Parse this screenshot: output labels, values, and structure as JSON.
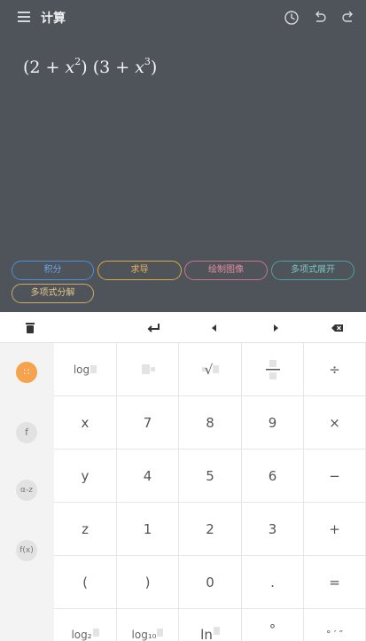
{
  "app": {
    "title": "计算"
  },
  "expression": {
    "part1_open": "(2 + ",
    "var1": "x",
    "exp1": "2",
    "part1_close": ")",
    "part2_open": "(3 + ",
    "var2": "x",
    "exp2": "3",
    "part2_close": ")"
  },
  "actions": [
    "积分",
    "求导",
    "绘制图像",
    "多项式展开",
    "多项式分解"
  ],
  "side_panel": [
    "∷",
    "f",
    "α-z",
    "f(x)"
  ],
  "keys": {
    "row1": [
      "log",
      "",
      "√",
      "",
      "÷"
    ],
    "row2": [
      "x",
      "7",
      "8",
      "9",
      "×"
    ],
    "row3": [
      "y",
      "4",
      "5",
      "6",
      "−"
    ],
    "row4": [
      "z",
      "1",
      "2",
      "3",
      "+"
    ],
    "row5": [
      "(",
      ")",
      "0",
      ".",
      "="
    ],
    "row6": [
      "log₂",
      "log₁₀",
      "ln",
      "°",
      "° ′ ″"
    ]
  },
  "colors": {
    "dark_bg": "#4f535a",
    "accent_orange": "#f5a34c"
  },
  "icons": {
    "appbar": [
      "menu-icon",
      "history-icon",
      "undo-icon",
      "redo-icon"
    ],
    "toolbar": [
      "trash-icon",
      "enter-icon",
      "left-arrow-icon",
      "right-arrow-icon",
      "backspace-icon"
    ]
  }
}
